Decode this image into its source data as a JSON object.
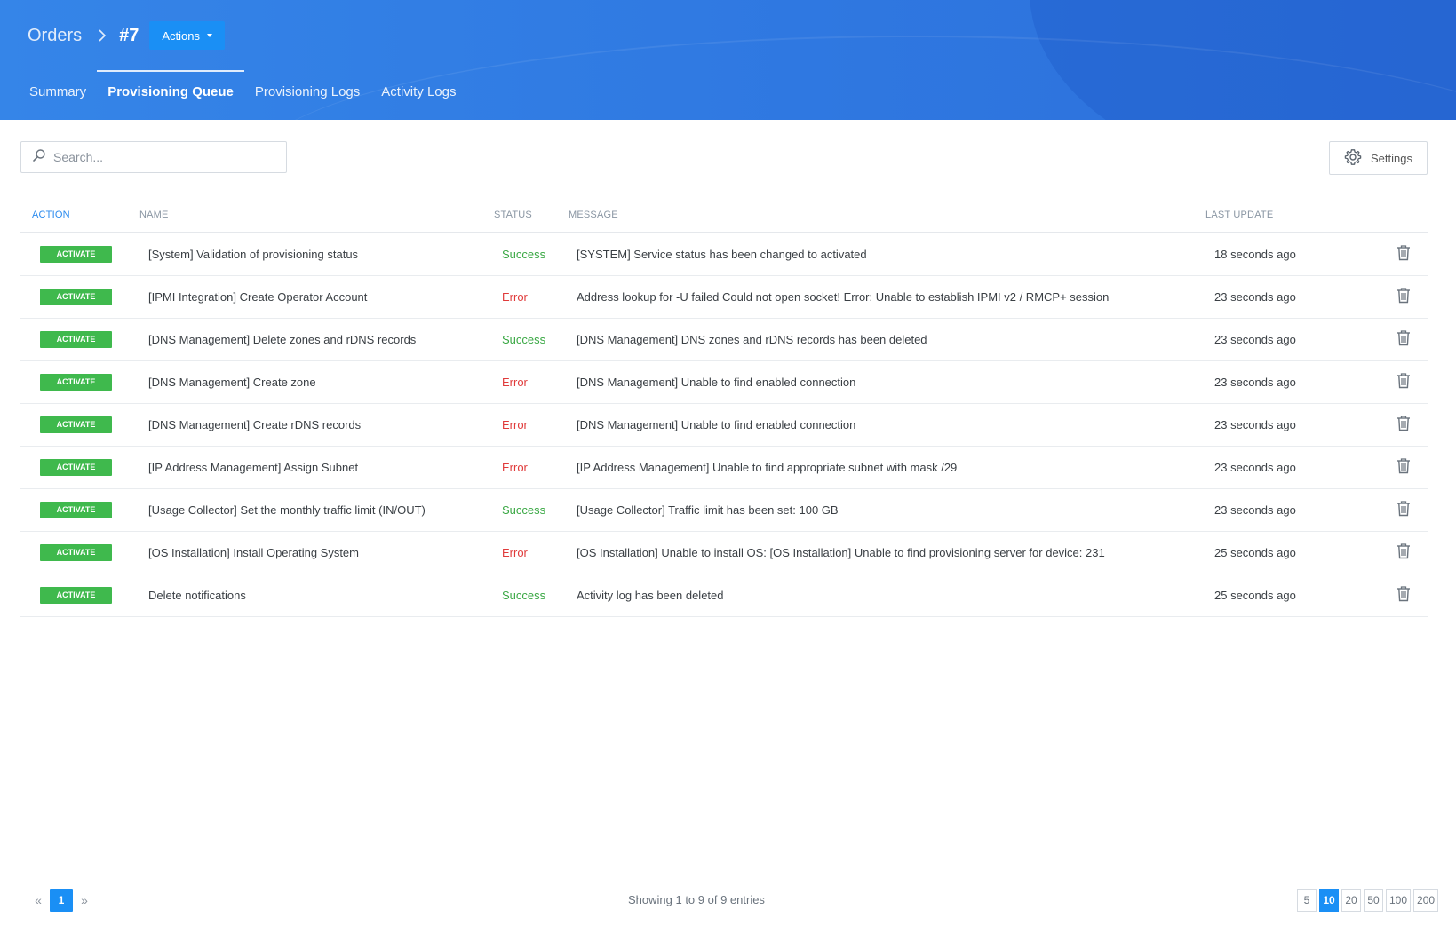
{
  "header": {
    "breadcrumb_root": "Orders",
    "order_id": "#7",
    "actions_label": "Actions"
  },
  "tabs": [
    {
      "label": "Summary",
      "active": false
    },
    {
      "label": "Provisioning Queue",
      "active": true
    },
    {
      "label": "Provisioning Logs",
      "active": false
    },
    {
      "label": "Activity Logs",
      "active": false
    }
  ],
  "toolbar": {
    "search_placeholder": "Search...",
    "search_value": "",
    "settings_label": "Settings"
  },
  "table": {
    "columns": [
      "ACTION",
      "NAME",
      "STATUS",
      "MESSAGE",
      "LAST UPDATE"
    ],
    "rows": [
      {
        "action": "ACTIVATE",
        "name": "[System] Validation of provisioning status",
        "status": "Success",
        "message": "[SYSTEM] Service status has been changed to activated",
        "updated": "18 seconds ago"
      },
      {
        "action": "ACTIVATE",
        "name": "[IPMI Integration] Create Operator Account",
        "status": "Error",
        "message": "Address lookup for -U failed Could not open socket! Error: Unable to establish IPMI v2 / RMCP+ session",
        "updated": "23 seconds ago"
      },
      {
        "action": "ACTIVATE",
        "name": "[DNS Management] Delete zones and rDNS records",
        "status": "Success",
        "message": "[DNS Management] DNS zones and rDNS records has been deleted",
        "updated": "23 seconds ago"
      },
      {
        "action": "ACTIVATE",
        "name": "[DNS Management] Create zone",
        "status": "Error",
        "message": "[DNS Management] Unable to find enabled connection",
        "updated": "23 seconds ago"
      },
      {
        "action": "ACTIVATE",
        "name": "[DNS Management] Create rDNS records",
        "status": "Error",
        "message": "[DNS Management] Unable to find enabled connection",
        "updated": "23 seconds ago"
      },
      {
        "action": "ACTIVATE",
        "name": "[IP Address Management] Assign Subnet",
        "status": "Error",
        "message": "[IP Address Management] Unable to find appropriate subnet with mask /29",
        "updated": "23 seconds ago"
      },
      {
        "action": "ACTIVATE",
        "name": "[Usage Collector] Set the monthly traffic limit (IN/OUT)",
        "status": "Success",
        "message": "[Usage Collector] Traffic limit has been set: 100 GB",
        "updated": "23 seconds ago"
      },
      {
        "action": "ACTIVATE",
        "name": "[OS Installation] Install Operating System",
        "status": "Error",
        "message": "[OS Installation] Unable to install OS: [OS Installation] Unable to find provisioning server for device: 231",
        "updated": "25 seconds ago"
      },
      {
        "action": "ACTIVATE",
        "name": "Delete notifications",
        "status": "Success",
        "message": "Activity log has been deleted",
        "updated": "25 seconds ago"
      }
    ]
  },
  "pagination": {
    "prev_icon": "double-chevron-left-icon",
    "next_icon": "double-chevron-right-icon",
    "current_page": "1",
    "showing_text": "Showing 1 to 9 of 9 entries",
    "page_sizes": [
      "5",
      "10",
      "20",
      "50",
      "100",
      "200"
    ],
    "selected_page_size": "10"
  },
  "colors": {
    "header_blue": "#2f78e1",
    "accent_blue": "#1a8ff5",
    "success_green": "#3aa844",
    "error_red": "#e03b3b",
    "badge_green": "#3fb94d"
  }
}
